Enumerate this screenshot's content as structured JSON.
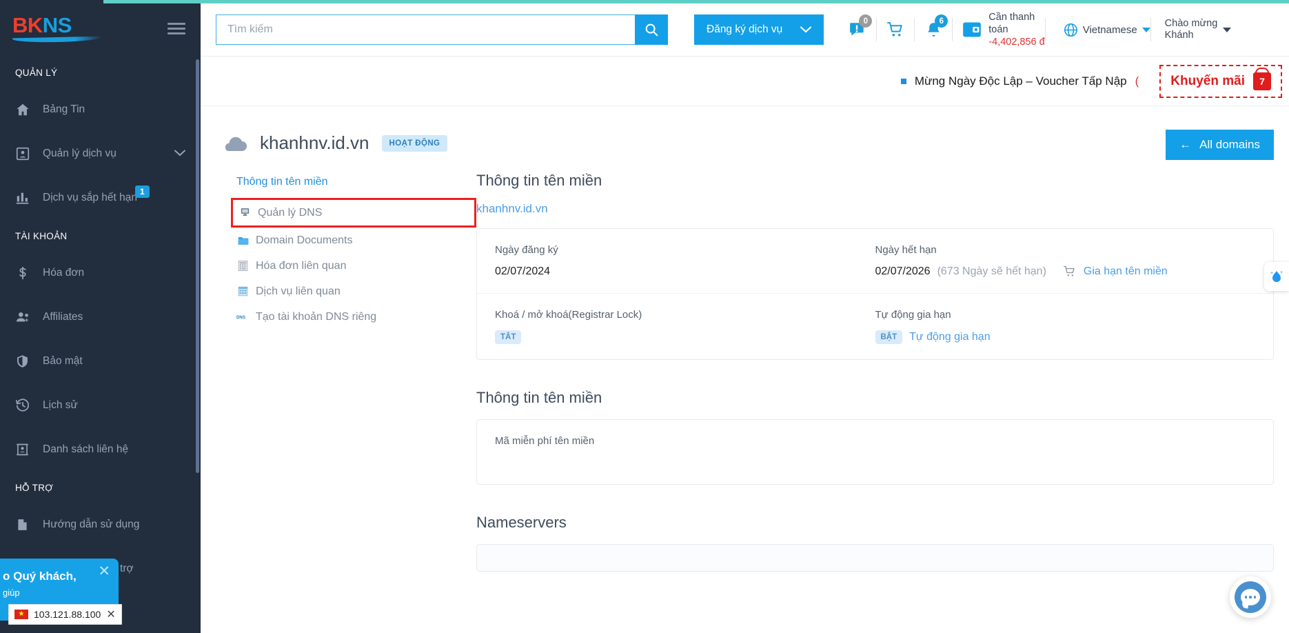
{
  "brand": {
    "b": "B",
    "k": "K",
    "n": "N",
    "s": "S"
  },
  "sidebar": {
    "sections": [
      {
        "title": "QUẢN LÝ",
        "items": [
          {
            "label": "Bảng Tin",
            "icon": "home-icon",
            "badge": null,
            "chevron": false
          },
          {
            "label": "Quản lý dịch vụ",
            "icon": "services-icon",
            "badge": null,
            "chevron": true
          },
          {
            "label": "Dịch vụ sắp hết hạn",
            "icon": "chart-icon",
            "badge": "1",
            "chevron": false
          }
        ]
      },
      {
        "title": "TÀI KHOẢN",
        "items": [
          {
            "label": "Hóa đơn",
            "icon": "dollar-icon",
            "badge": null,
            "chevron": false
          },
          {
            "label": "Affiliates",
            "icon": "user-plus-icon",
            "badge": null,
            "chevron": false
          },
          {
            "label": "Bảo mật",
            "icon": "shield-icon",
            "badge": null,
            "chevron": false
          },
          {
            "label": "Lịch sử",
            "icon": "history-icon",
            "badge": null,
            "chevron": false
          },
          {
            "label": "Danh sách liên hệ",
            "icon": "contacts-icon",
            "badge": null,
            "chevron": false
          }
        ]
      },
      {
        "title": "HỖ TRỢ",
        "items": [
          {
            "label": "Hướng dẫn sử dụng",
            "icon": "document-icon",
            "badge": null,
            "chevron": false
          },
          {
            "label": "Các yêu cầu hỗ trợ",
            "icon": "support-icon",
            "badge": null,
            "chevron": false
          }
        ]
      }
    ]
  },
  "chat_popup": {
    "title": "o Quý khách,",
    "subtitle": "giúp",
    "close": "✕"
  },
  "ip_chip": {
    "ip": "103.121.88.100",
    "close": "✕",
    "flag": "★"
  },
  "header": {
    "search": {
      "placeholder": "Tìm kiếm",
      "value": "",
      "icon": "search-icon"
    },
    "register_button": {
      "label": "Đăng ký dịch vụ",
      "icon": "chevron-down-icon"
    },
    "alerts": {
      "icon": "alert-message-icon",
      "count": "0"
    },
    "cart": {
      "icon": "cart-icon"
    },
    "notifications": {
      "icon": "bell-icon",
      "count": "6"
    },
    "payment": {
      "icon": "wallet-icon",
      "label": "Cần thanh toán",
      "amount": "-4,402,856 đ"
    },
    "language": {
      "icon": "globe-icon",
      "label": "Vietnamese"
    },
    "user": {
      "greeting": "Chào mừng",
      "name": "Khánh"
    }
  },
  "promo": {
    "text": "Mừng Ngày Độc Lập – Voucher Tấp Nập",
    "tail": "(",
    "button_label": "Khuyến mãi",
    "gift_count": "7"
  },
  "page": {
    "domain": "khanhnv.id.vn",
    "status": "HOẠT ĐỘNG",
    "all_domains_button": "All domains",
    "back_arrow": "←"
  },
  "left_menu": {
    "title": "Thông tin tên miền",
    "items": [
      {
        "label": "Quản lý DNS",
        "icon": "server-icon",
        "selected": true
      },
      {
        "label": "Domain Documents",
        "icon": "folder-icon",
        "selected": false
      },
      {
        "label": "Hóa đơn liên quan",
        "icon": "invoice-icon",
        "selected": false
      },
      {
        "label": "Dịch vụ liên quan",
        "icon": "grid-icon",
        "selected": false
      },
      {
        "label": "Tạo tài khoản DNS riêng",
        "icon": "dns-icon",
        "selected": false
      }
    ]
  },
  "domain_info": {
    "section_title": "Thông tin tên miền",
    "domain_link": "khanhnv.id.vn",
    "fields": {
      "reg_date_label": "Ngày đăng ký",
      "reg_date_value": "02/07/2024",
      "exp_date_label": "Ngày hết hạn",
      "exp_date_value": "02/07/2026",
      "exp_date_note": "(673 Ngày sẽ hết hạn)",
      "renew_link": "Gia hạn tên miền",
      "renew_icon": "cart-icon",
      "lock_label": "Khoá / mở khoá(Registrar Lock)",
      "lock_state": "TẮT",
      "autorenew_label": "Tự động gia hạn",
      "autorenew_state": "BẬT",
      "autorenew_link": "Tự động gia hạn"
    }
  },
  "free_section": {
    "title": "Thông tin tên miền",
    "label": "Mã miễn phí tên miền"
  },
  "nameservers": {
    "title": "Nameservers"
  },
  "widgets": {
    "drop_icon": "water-drop-icon",
    "chat_icon": "chat-bubble-icon"
  },
  "colors": {
    "accent": "#13a0e8",
    "sidebar": "#222d3d",
    "danger": "#e03131",
    "teal": "#5ecfc6"
  }
}
